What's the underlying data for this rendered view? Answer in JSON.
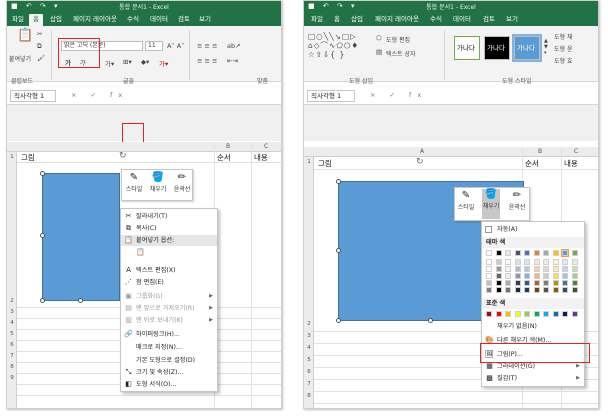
{
  "left": {
    "titlebar": {
      "qat": "■ ↶ ↷ ▾",
      "title": "통합 문서1 - Excel"
    },
    "tabs": [
      "파일",
      "홈",
      "삽입",
      "페이지 레이아웃",
      "수식",
      "데이터",
      "검토",
      "보기"
    ],
    "ribbon": {
      "paste_label": "붙여넣기",
      "font_name": "맑은 고딕 (본문)",
      "font_size": "11",
      "bold": "가",
      "italic": "가",
      "groups": {
        "clipboard": "클립보드",
        "font": "글꼴",
        "align": "맞춤"
      }
    },
    "namebox": "직사각형 1",
    "formula_icons": "× ✓ fx",
    "columns": [
      "B",
      "C"
    ],
    "rows": [
      "1",
      "2",
      "3",
      "4",
      "5",
      "6",
      "7",
      "8",
      "9"
    ],
    "cells": {
      "a1": "그림",
      "b1": "순서",
      "c1": "내용"
    },
    "mini_toolbar": [
      {
        "icon": "style-icon",
        "label": "스타일"
      },
      {
        "icon": "fill-icon",
        "label": "채우기"
      },
      {
        "icon": "outline-icon",
        "label": "윤곽선"
      }
    ],
    "context_menu": [
      {
        "icon": "✂",
        "label": "잘라내기(T)",
        "disabled": false
      },
      {
        "icon": "⧉",
        "label": "복사(C)",
        "disabled": false
      },
      {
        "icon": "📋",
        "label": "붙여넣기 옵션:",
        "disabled": false,
        "highlight": true
      },
      {
        "icon": "📋",
        "label": "",
        "disabled": false
      },
      {
        "icon": "A",
        "label": "텍스트 편집(X)",
        "disabled": false
      },
      {
        "icon": "⋰",
        "label": "점 편집(E)",
        "disabled": false
      },
      {
        "icon": "▣",
        "label": "그룹화(G)",
        "disabled": true,
        "submenu": true
      },
      {
        "icon": "▤",
        "label": "맨 앞으로 가져오기(R)",
        "disabled": true,
        "submenu": true
      },
      {
        "icon": "▥",
        "label": "맨 뒤로 보내기(K)",
        "disabled": true,
        "submenu": true
      },
      {
        "icon": "🔗",
        "label": "하이퍼링크(H)...",
        "disabled": false
      },
      {
        "icon": "",
        "label": "매크로 지정(N)...",
        "disabled": false
      },
      {
        "icon": "",
        "label": "기본 도형으로 설정(D)",
        "disabled": false
      },
      {
        "icon": "⤡",
        "label": "크기 및 속성(Z)...",
        "disabled": false
      },
      {
        "icon": "◧",
        "label": "도형 서식(O)...",
        "disabled": false
      }
    ]
  },
  "right": {
    "titlebar": {
      "qat": "■ ↶ ↷ ▾",
      "title": "통합 문서1 - Excel"
    },
    "tabs": [
      "파일",
      "홈",
      "삽입",
      "페이지 레이아웃",
      "수식",
      "데이터",
      "검토",
      "보기"
    ],
    "ribbon": {
      "edit_shape": "도형 편집",
      "text_box": "텍스트 상자",
      "style_samples": [
        "가나다",
        "가나다",
        "가나다"
      ],
      "shape_fill": "도형 채",
      "shape_outline": "도형 윤",
      "shape_effect": "도형 효",
      "groups": {
        "insert_shapes": "도형 삽입",
        "shape_styles": "도형 스타일"
      }
    },
    "namebox": "직사각형 1",
    "formula_icons": "× ✓ fx",
    "columns": [
      "A",
      "B",
      "C"
    ],
    "rows": [
      "1",
      "2",
      "3",
      "4",
      "5",
      "6",
      "7",
      "8"
    ],
    "cells": {
      "a1": "그림",
      "b1": "순서",
      "c1": "내용"
    },
    "mini_toolbar": [
      {
        "icon": "style-icon",
        "label": "스타일"
      },
      {
        "icon": "fill-icon",
        "label": "채우기"
      },
      {
        "icon": "outline-icon",
        "label": "윤곽선"
      }
    ],
    "fill_menu": {
      "auto": "자동(A)",
      "theme_colors": "테마 색",
      "standard_colors": "표준 색",
      "no_fill": "채우기 없음(N)",
      "more_colors": "다른 채우기 색(M)...",
      "picture": "그림(P)...",
      "gradient": "그라데이션(G)",
      "texture": "질감(T)"
    },
    "theme_colors": [
      "#ffffff",
      "#000000",
      "#e7e6e6",
      "#44546a",
      "#4472c4",
      "#ed7d31",
      "#a5a5a5",
      "#ffc000",
      "#5b9bd5",
      "#70ad47"
    ],
    "standard_colors": [
      "#c00000",
      "#ff0000",
      "#ffc000",
      "#ffff00",
      "#92d050",
      "#00b050",
      "#00b0f0",
      "#0070c0",
      "#002060",
      "#7030a0"
    ]
  }
}
